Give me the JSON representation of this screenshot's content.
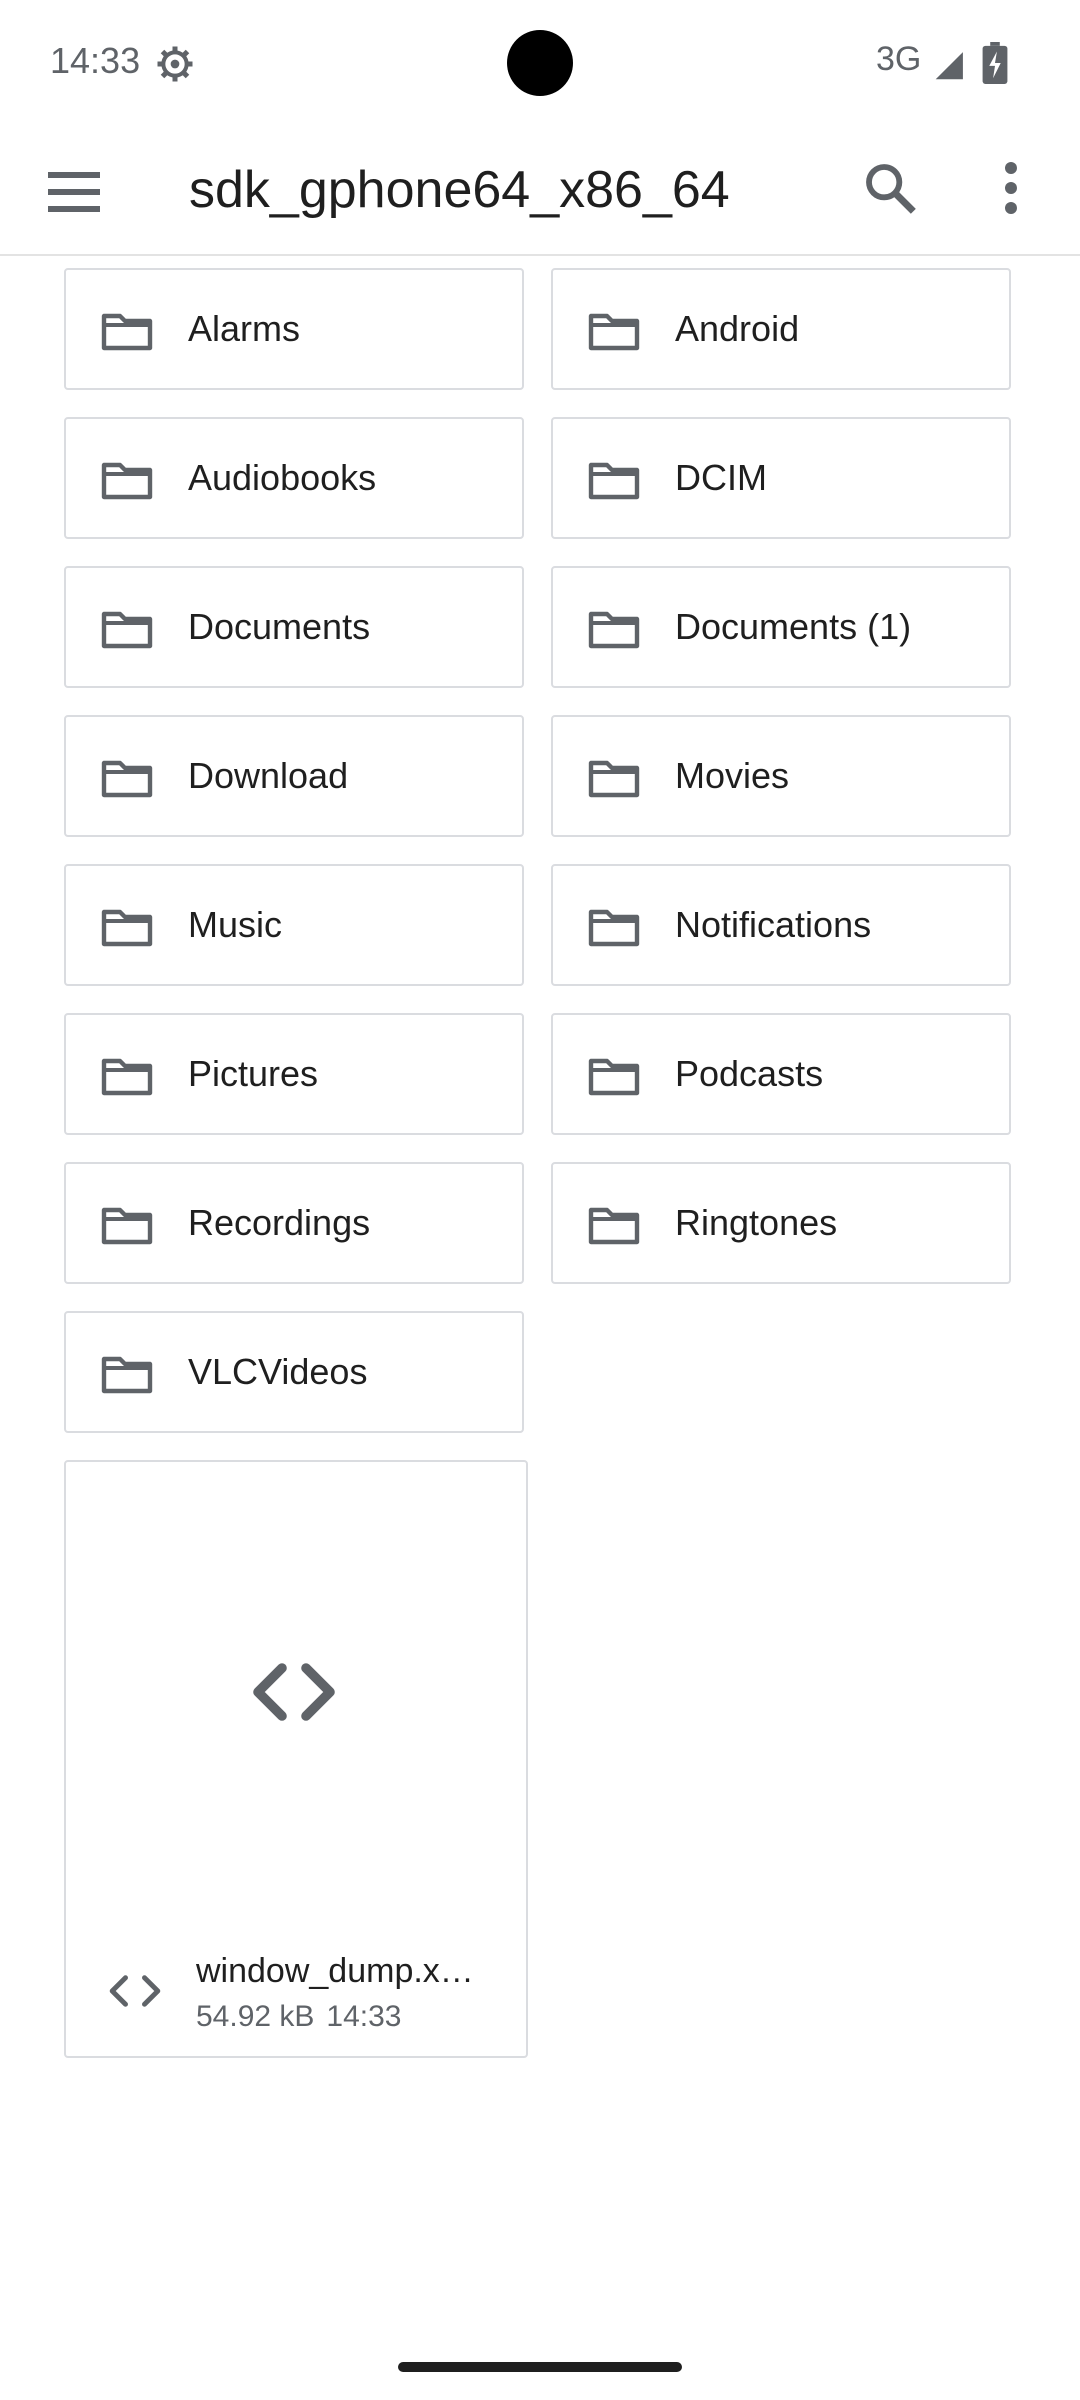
{
  "status_bar": {
    "time": "14:33",
    "network": "3G",
    "icons": [
      "settings-gear-icon",
      "signal-icon",
      "battery-charging-icon"
    ]
  },
  "toolbar": {
    "title": "sdk_gphone64_x86_64",
    "icons": [
      "hamburger-menu-icon",
      "search-icon",
      "more-vert-icon"
    ]
  },
  "folders": [
    {
      "label": "Alarms"
    },
    {
      "label": "Android"
    },
    {
      "label": "Audiobooks"
    },
    {
      "label": "DCIM"
    },
    {
      "label": "Documents"
    },
    {
      "label": "Documents (1)"
    },
    {
      "label": "Download"
    },
    {
      "label": "Movies"
    },
    {
      "label": "Music"
    },
    {
      "label": "Notifications"
    },
    {
      "label": "Pictures"
    },
    {
      "label": "Podcasts"
    },
    {
      "label": "Recordings"
    },
    {
      "label": "Ringtones"
    },
    {
      "label": "VLCVideos"
    }
  ],
  "file": {
    "name": "window_dump.x…",
    "size": "54.92 kB",
    "time": "14:33",
    "icon": "code-file-icon"
  },
  "colors": {
    "icon_gray": "#5f6368",
    "border": "#dadce0",
    "text": "#1f1f1f"
  }
}
